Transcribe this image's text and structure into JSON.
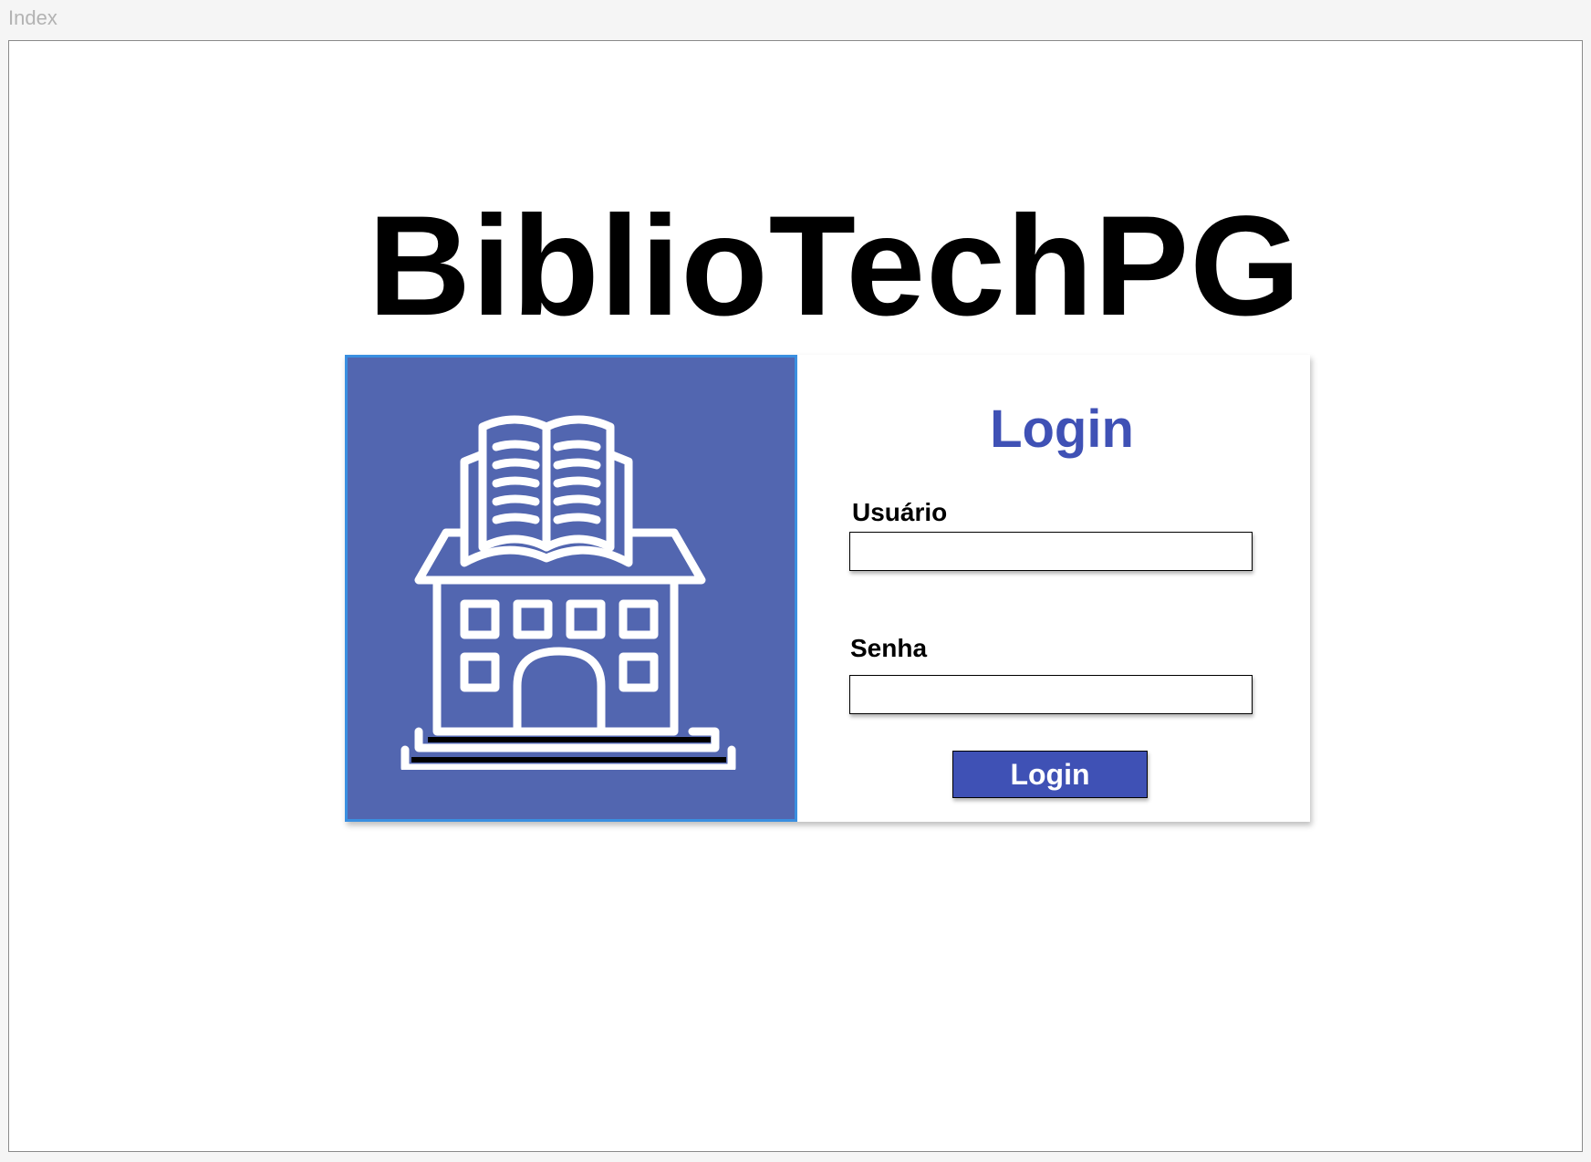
{
  "window": {
    "title": "Index"
  },
  "app": {
    "title": "BiblioTechPG"
  },
  "logo": {
    "icon": "library-building-icon",
    "background_color": "#5266b0",
    "border_color": "#3a8fe0"
  },
  "login_form": {
    "heading": "Login",
    "username_label": "Usuário",
    "username_value": "",
    "password_label": "Senha",
    "password_value": "",
    "submit_label": "Login",
    "accent_color": "#3f51b5"
  }
}
